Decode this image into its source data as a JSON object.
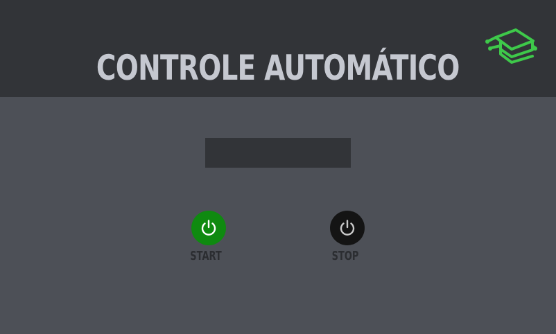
{
  "header": {
    "title": "CONTROLE AUTOMÁTICO",
    "logo_icon": "graduation-cap-circuit-logo",
    "logo_color": "#3ec94a"
  },
  "display": {
    "value": ""
  },
  "controls": {
    "start": {
      "label": "START",
      "icon": "power-icon",
      "color": "#0f8a10"
    },
    "stop": {
      "label": "STOP",
      "icon": "power-icon",
      "color": "#141414"
    }
  }
}
